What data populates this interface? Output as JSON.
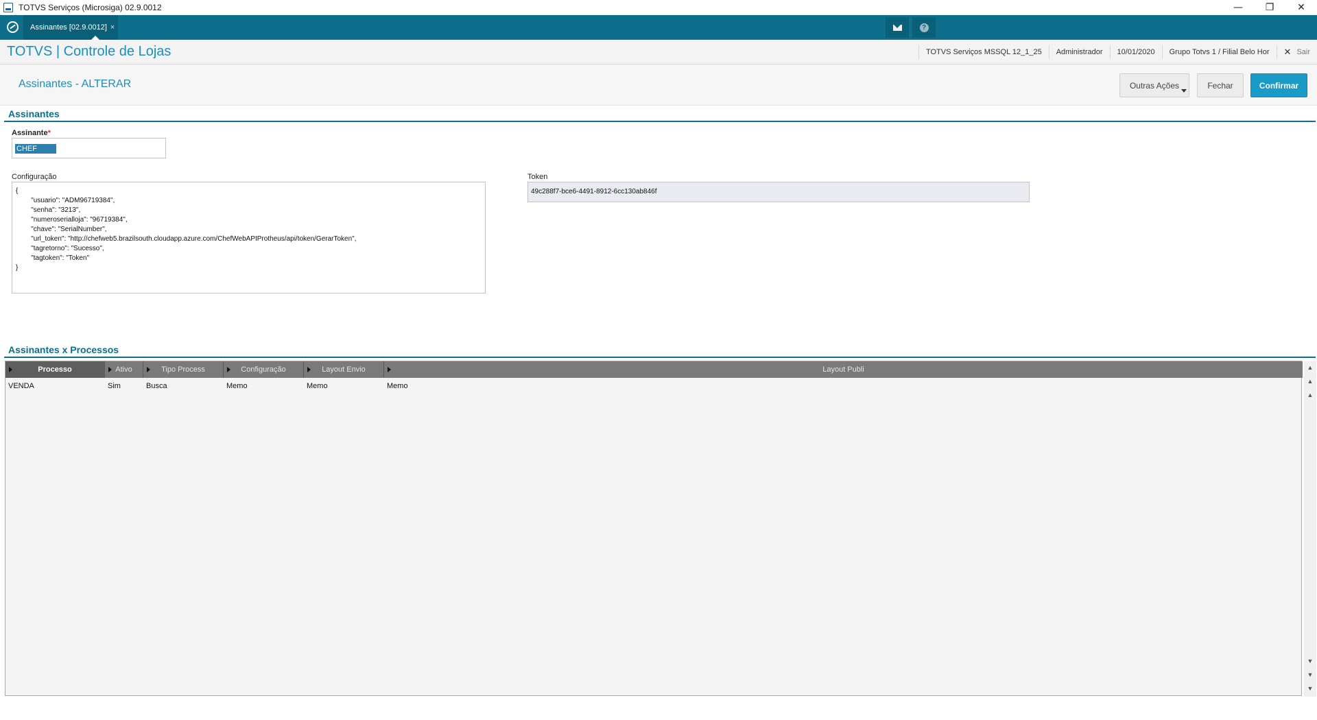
{
  "window": {
    "title": "TOTVS Serviços (Microsiga) 02.9.0012",
    "minimize": "—",
    "restore": "❐",
    "close": "✕"
  },
  "tabbar": {
    "tab_label": "Assinantes [02.9.0012]",
    "tab_close": "×",
    "help_glyph": "?"
  },
  "header": {
    "app_name": "TOTVS | Controle de Lojas",
    "environment": "TOTVS Serviços MSSQL 12_1_25",
    "user": "Administrador",
    "date": "10/01/2020",
    "branch": "Grupo Totvs 1 / Filial Belo Hor",
    "exit_icon": "✕",
    "exit_label": "Sair"
  },
  "page": {
    "title": "Assinantes - ALTERAR",
    "btn_outras": "Outras Ações",
    "btn_fechar": "Fechar",
    "btn_confirmar": "Confirmar"
  },
  "form": {
    "section_title": "Assinantes",
    "assinante_label": "Assinante",
    "required_mark": "*",
    "assinante_value": "CHEF",
    "config_label": "Configuração",
    "config_value": "{\n        \"usuario\": \"ADM96719384\",\n        \"senha\": \"3213\",\n        \"numeroserialloja\": \"96719384\",\n        \"chave\": \"SerialNumber\",\n        \"url_token\": \"http://chefweb5.brazilsouth.cloudapp.azure.com/ChefWebAPIProtheus/api/token/GerarToken\",\n        \"tagretorno\": \"Sucesso\",\n        \"tagtoken\": \"Token\"\n}",
    "token_label": "Token",
    "token_value": "49c288f7-bce6-4491-8912-6cc130ab846f"
  },
  "grid": {
    "section_title": "Assinantes x Processos",
    "columns": [
      "Processo",
      "Ativo",
      "Tipo Process",
      "Configuração",
      "Layout Envio",
      "Layout Publi"
    ],
    "rows": [
      [
        "VENDA",
        "Sim",
        "Busca",
        "Memo",
        "Memo",
        "Memo"
      ]
    ],
    "scroll_up": "▲",
    "scroll_down": "▼"
  }
}
